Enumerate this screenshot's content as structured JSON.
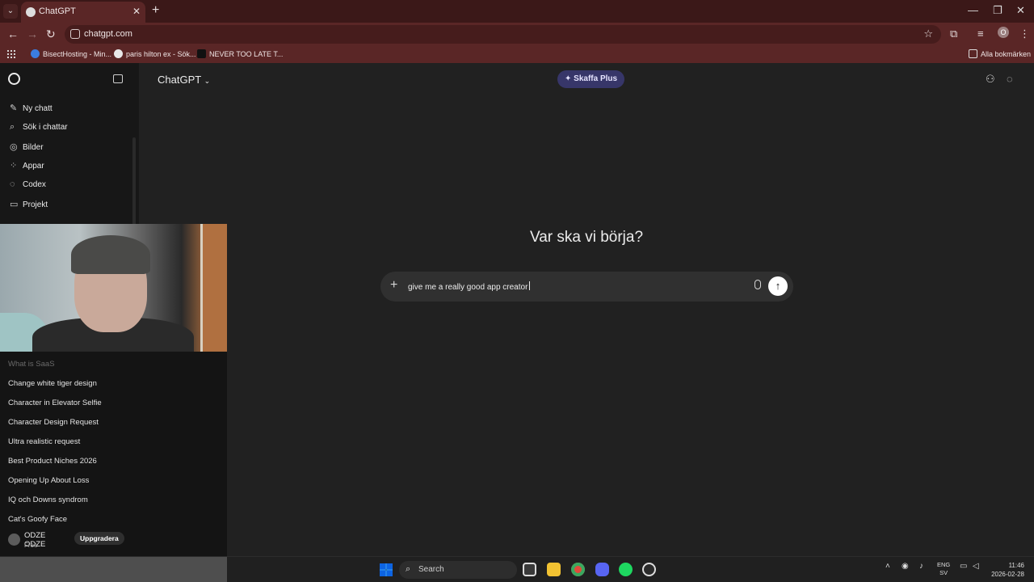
{
  "browser": {
    "tab_title": "ChatGPT",
    "url": "chatgpt.com",
    "bookmarks": [
      {
        "label": "BisectHosting - Min..."
      },
      {
        "label": "paris hilton ex - Sök..."
      },
      {
        "label": "NEVER TOO LATE T..."
      }
    ],
    "all_bookmarks": "Alla bokmärken",
    "profile_initial": "O"
  },
  "sidebar": {
    "nav": [
      {
        "label": "Ny chatt",
        "icon": "edit-icon"
      },
      {
        "label": "Sök i chattar",
        "icon": "search-icon"
      },
      {
        "label": "Bilder",
        "icon": "images-icon"
      },
      {
        "label": "Appar",
        "icon": "apps-icon"
      },
      {
        "label": "Codex",
        "icon": "codex-icon"
      },
      {
        "label": "Projekt",
        "icon": "folder-icon"
      }
    ],
    "history": [
      "What is SaaS",
      "Change white tiger design",
      "Character in Elevator Selfie",
      "Character Design Request",
      "Ultra realistic request",
      "Best Product Niches 2026",
      "Opening Up About Loss",
      "IQ och Downs syndrom",
      "Cat's Goofy Face"
    ],
    "user": {
      "name": "ODZE ODZE",
      "plan": "Free",
      "upgrade": "Uppgradera"
    }
  },
  "main": {
    "model": "ChatGPT",
    "plus_button": "Skaffa Plus",
    "heading": "Var ska vi börja?",
    "composer_value": "give me a really good app creator"
  },
  "taskbar": {
    "search": "Search",
    "lang_top": "ENG",
    "lang_bottom": "SV",
    "time": "11:46",
    "date": "2026-02-28"
  }
}
